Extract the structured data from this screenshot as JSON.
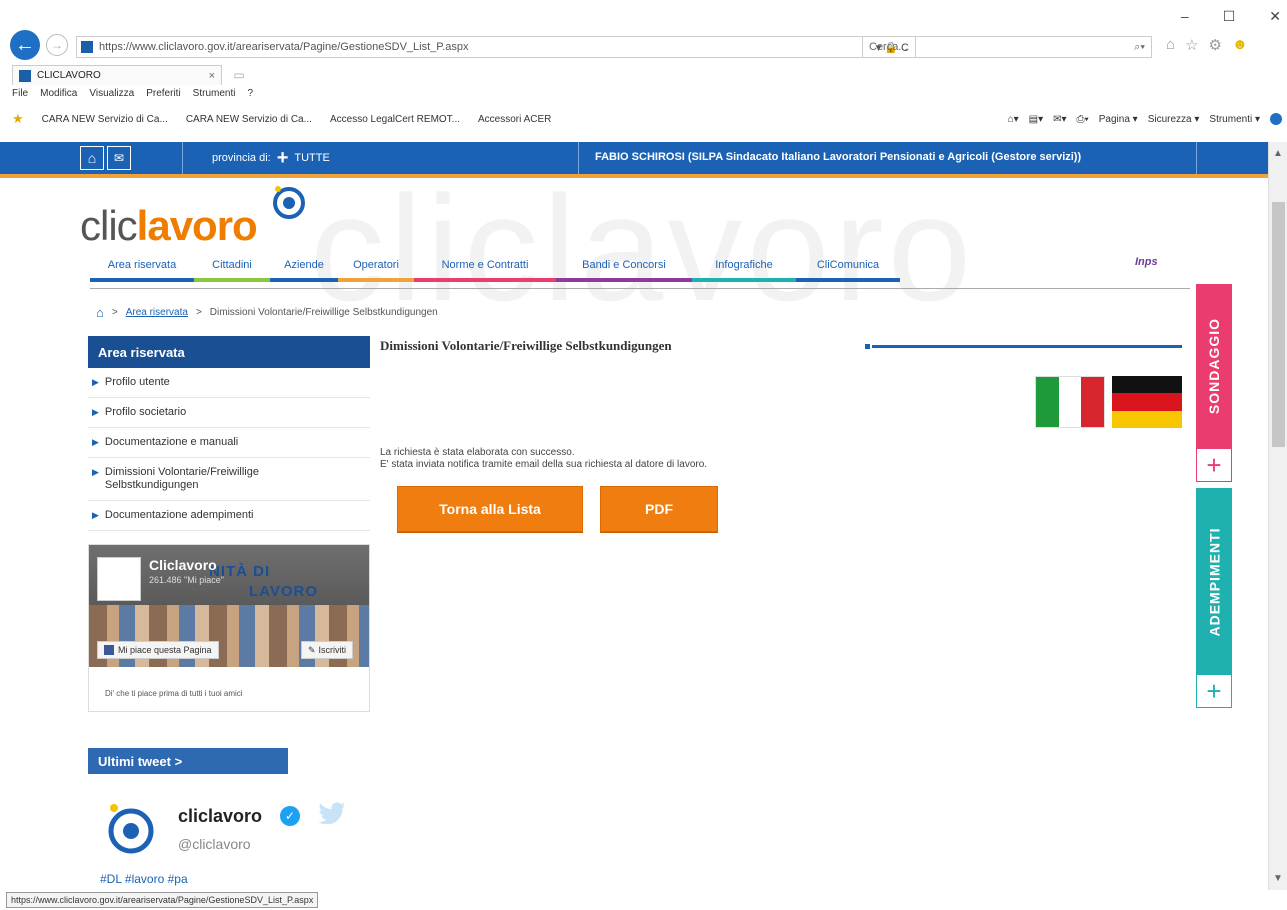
{
  "browser": {
    "url": "https://www.cliclavoro.gov.it/areariservata/Pagine/GestioneSDV_List_P.aspx",
    "url_actions": "▾ 🔒 C",
    "search_placeholder": "Cerca...",
    "tab_title": "CLICLAVORO",
    "menu": [
      "File",
      "Modifica",
      "Visualizza",
      "Preferiti",
      "Strumenti",
      "?"
    ],
    "favorites": [
      "CARA NEW Servizio di Ca...",
      "CARA NEW Servizio di Ca...",
      "Accesso LegalCert REMOT...",
      "Accessori ACER"
    ],
    "command_bar": [
      "Pagina ▾",
      "Sicurezza ▾",
      "Strumenti ▾"
    ],
    "status_url": "https://www.cliclavoro.gov.it/areariservata/Pagine/GestioneSDV_List_P.aspx"
  },
  "topbar": {
    "province_label": "provincia di:",
    "province_value": "TUTTE",
    "user": "FABIO SCHIROSI (SILPA Sindacato Italiano Lavoratori Pensionati e Agricoli (Gestore servizi))"
  },
  "logo": {
    "part1": "clic",
    "part2": "lavoro"
  },
  "watermark": "cliclavoro",
  "partner_logo": "Inps",
  "nav": [
    {
      "label": "Area riservata",
      "color": "#1b62b5"
    },
    {
      "label": "Cittadini",
      "color": "#8dc63f"
    },
    {
      "label": "Aziende",
      "color": "#1b62b5"
    },
    {
      "label": "Operatori",
      "color": "#f0a33a"
    },
    {
      "label": "Norme e Contratti",
      "color": "#ea3c6e"
    },
    {
      "label": "Bandi e Concorsi",
      "color": "#8e3a9d"
    },
    {
      "label": "Infografiche",
      "color": "#1fb0b0"
    },
    {
      "label": "CliComunica",
      "color": "#1b62b5"
    }
  ],
  "breadcrumb": {
    "link": "Area riservata",
    "current": "Dimissioni Volontarie/Freiwillige Selbstkundigungen",
    "separator": ">"
  },
  "sidebar": {
    "header": "Area riservata",
    "items": [
      "Profilo utente",
      "Profilo societario",
      "Documentazione e manuali",
      "Dimissioni Volontarie/Freiwillige Selbstkundigungen",
      "Documentazione adempimenti"
    ]
  },
  "facebook": {
    "page_title": "Cliclavoro",
    "page_sub": "261.486 \"Mi piace\"",
    "banner_line1": "NITÀ DI",
    "banner_line2": "LAVORO",
    "like_label": "Mi piace questa Pagina",
    "share_label": "Iscriviti",
    "caption": "Di' che ti piace prima di tutti i tuoi amici"
  },
  "tweets": {
    "header": "Ultimi tweet >",
    "name": "cliclavoro",
    "handle": "@cliclavoro",
    "snippet": "#DL #lavoro #pa"
  },
  "content": {
    "title": "Dimissioni Volontarie/Freiwillige Selbstkundigungen",
    "message1": "La richiesta è stata elaborata con successo.",
    "message2": "E' stata inviata notifica tramite email della sua richiesta al datore di lavoro.",
    "btn_back": "Torna alla Lista",
    "btn_pdf": "PDF"
  },
  "side_tabs": {
    "survey": "SONDAGGIO",
    "fulfillments": "ADEMPIMENTI"
  },
  "colors": {
    "brand_blue": "#1b62b5",
    "orange": "#ef7d10",
    "pink": "#ea3c6e",
    "teal": "#1fb0b0"
  }
}
